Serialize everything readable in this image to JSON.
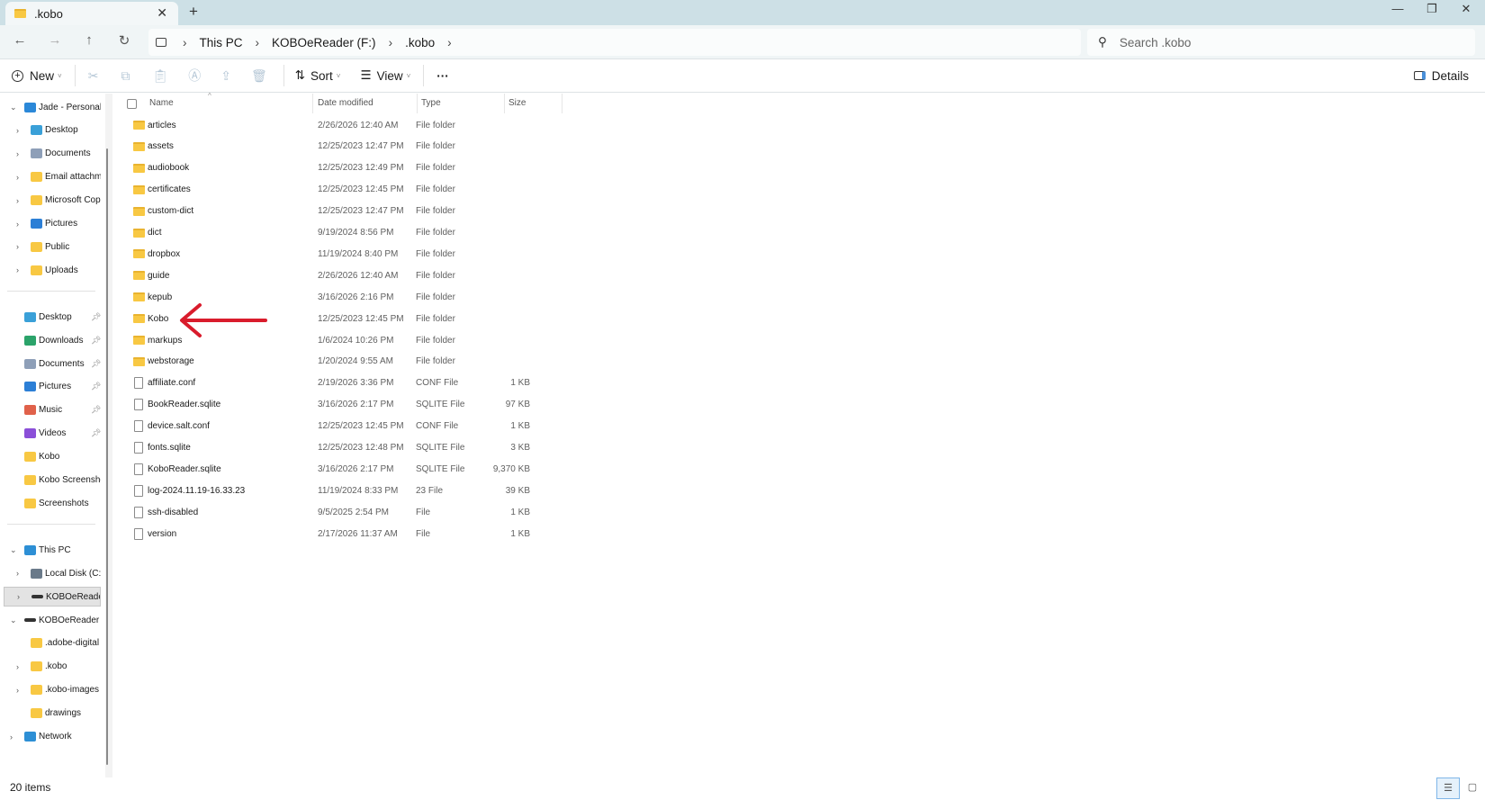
{
  "window": {
    "tab_title": ".kobo",
    "tab_close_icon": "close-icon",
    "new_tab_label": "+",
    "minimize_label": "—",
    "restore_label": "❐",
    "close_label": "✕"
  },
  "nav": {
    "back": "←",
    "forward": "→",
    "up": "↑",
    "refresh": "↻",
    "breadcrumb": [
      "This PC",
      "KOBOeReader (F:)",
      ".kobo"
    ],
    "search_placeholder": "Search .kobo"
  },
  "toolbar": {
    "new_label": "New",
    "sort_label": "Sort",
    "view_label": "View",
    "more_label": "···",
    "details_label": "Details"
  },
  "columns": {
    "name": "Name",
    "date": "Date modified",
    "type": "Type",
    "size": "Size"
  },
  "sidebar": {
    "items": [
      {
        "label": "Jade - Personal",
        "icon": "cloud-icon",
        "depth": 0,
        "expander": "down"
      },
      {
        "label": "Desktop",
        "icon": "desktop-icon",
        "depth": 1,
        "expander": "right"
      },
      {
        "label": "Documents",
        "icon": "documents-icon",
        "depth": 1,
        "expander": "right"
      },
      {
        "label": "Email attachm",
        "icon": "folder-icon",
        "depth": 1,
        "expander": "right"
      },
      {
        "label": "Microsoft Copi",
        "icon": "folder-icon",
        "depth": 1,
        "expander": "right"
      },
      {
        "label": "Pictures",
        "icon": "pictures-icon",
        "depth": 1,
        "expander": "right"
      },
      {
        "label": "Public",
        "icon": "folder-icon",
        "depth": 1,
        "expander": "right"
      },
      {
        "label": "Uploads",
        "icon": "folder-icon",
        "depth": 1,
        "expander": "right"
      },
      {
        "divider": true
      },
      {
        "label": "Desktop",
        "icon": "desktop-icon",
        "depth": 0,
        "pinned": true
      },
      {
        "label": "Downloads",
        "icon": "downloads-icon",
        "depth": 0,
        "pinned": true
      },
      {
        "label": "Documents",
        "icon": "documents-icon",
        "depth": 0,
        "pinned": true
      },
      {
        "label": "Pictures",
        "icon": "pictures-icon",
        "depth": 0,
        "pinned": true
      },
      {
        "label": "Music",
        "icon": "music-icon",
        "depth": 0,
        "pinned": true
      },
      {
        "label": "Videos",
        "icon": "videos-icon",
        "depth": 0,
        "pinned": true
      },
      {
        "label": "Kobo",
        "icon": "folder-icon",
        "depth": 0
      },
      {
        "label": "Kobo Screensho",
        "icon": "folder-icon",
        "depth": 0
      },
      {
        "label": "Screenshots",
        "icon": "folder-icon",
        "depth": 0
      },
      {
        "divider": true
      },
      {
        "label": "This PC",
        "icon": "this-pc-icon",
        "depth": 0,
        "expander": "down"
      },
      {
        "label": "Local Disk (C:)",
        "icon": "local-disk-icon",
        "depth": 1,
        "expander": "right"
      },
      {
        "label": "KOBOeReader",
        "icon": "drive-icon",
        "depth": 1,
        "expander": "right",
        "selected": true
      },
      {
        "label": "KOBOeReader (I",
        "icon": "drive-icon",
        "depth": 0,
        "expander": "down"
      },
      {
        "label": ".adobe-digital",
        "icon": "folder-icon",
        "depth": 1
      },
      {
        "label": ".kobo",
        "icon": "folder-icon",
        "depth": 1,
        "expander": "right"
      },
      {
        "label": ".kobo-images",
        "icon": "folder-icon",
        "depth": 1,
        "expander": "right"
      },
      {
        "label": "drawings",
        "icon": "folder-icon",
        "depth": 1
      },
      {
        "label": "Network",
        "icon": "network-icon",
        "depth": 0,
        "expander": "right"
      }
    ]
  },
  "files": [
    {
      "name": "articles",
      "date": "2/26/2026 12:40 AM",
      "type": "File folder",
      "size": "",
      "kind": "folder"
    },
    {
      "name": "assets",
      "date": "12/25/2023 12:47 PM",
      "type": "File folder",
      "size": "",
      "kind": "folder"
    },
    {
      "name": "audiobook",
      "date": "12/25/2023 12:49 PM",
      "type": "File folder",
      "size": "",
      "kind": "folder"
    },
    {
      "name": "certificates",
      "date": "12/25/2023 12:45 PM",
      "type": "File folder",
      "size": "",
      "kind": "folder"
    },
    {
      "name": "custom-dict",
      "date": "12/25/2023 12:47 PM",
      "type": "File folder",
      "size": "",
      "kind": "folder"
    },
    {
      "name": "dict",
      "date": "9/19/2024 8:56 PM",
      "type": "File folder",
      "size": "",
      "kind": "folder"
    },
    {
      "name": "dropbox",
      "date": "11/19/2024 8:40 PM",
      "type": "File folder",
      "size": "",
      "kind": "folder"
    },
    {
      "name": "guide",
      "date": "2/26/2026 12:40 AM",
      "type": "File folder",
      "size": "",
      "kind": "folder"
    },
    {
      "name": "kepub",
      "date": "3/16/2026 2:16 PM",
      "type": "File folder",
      "size": "",
      "kind": "folder"
    },
    {
      "name": "Kobo",
      "date": "12/25/2023 12:45 PM",
      "type": "File folder",
      "size": "",
      "kind": "folder",
      "annotated": true
    },
    {
      "name": "markups",
      "date": "1/6/2024 10:26 PM",
      "type": "File folder",
      "size": "",
      "kind": "folder"
    },
    {
      "name": "webstorage",
      "date": "1/20/2024 9:55 AM",
      "type": "File folder",
      "size": "",
      "kind": "folder"
    },
    {
      "name": "affiliate.conf",
      "date": "2/19/2026 3:36 PM",
      "type": "CONF File",
      "size": "1 KB",
      "kind": "file"
    },
    {
      "name": "BookReader.sqlite",
      "date": "3/16/2026 2:17 PM",
      "type": "SQLITE File",
      "size": "97 KB",
      "kind": "file"
    },
    {
      "name": "device.salt.conf",
      "date": "12/25/2023 12:45 PM",
      "type": "CONF File",
      "size": "1 KB",
      "kind": "file"
    },
    {
      "name": "fonts.sqlite",
      "date": "12/25/2023 12:48 PM",
      "type": "SQLITE File",
      "size": "3 KB",
      "kind": "file"
    },
    {
      "name": "KoboReader.sqlite",
      "date": "3/16/2026 2:17 PM",
      "type": "SQLITE File",
      "size": "9,370 KB",
      "kind": "file"
    },
    {
      "name": "log-2024.11.19-16.33.23",
      "date": "11/19/2024 8:33 PM",
      "type": "23 File",
      "size": "39 KB",
      "kind": "file"
    },
    {
      "name": "ssh-disabled",
      "date": "9/5/2025 2:54 PM",
      "type": "File",
      "size": "1 KB",
      "kind": "file"
    },
    {
      "name": "version",
      "date": "2/17/2026 11:37 AM",
      "type": "File",
      "size": "1 KB",
      "kind": "file"
    }
  ],
  "status": {
    "item_count": "20 items"
  },
  "colors": {
    "accent": "#0067c0",
    "annotation_arrow": "#d91c2c",
    "folder": "#f8c843",
    "titlebar": "#cde0e6"
  }
}
